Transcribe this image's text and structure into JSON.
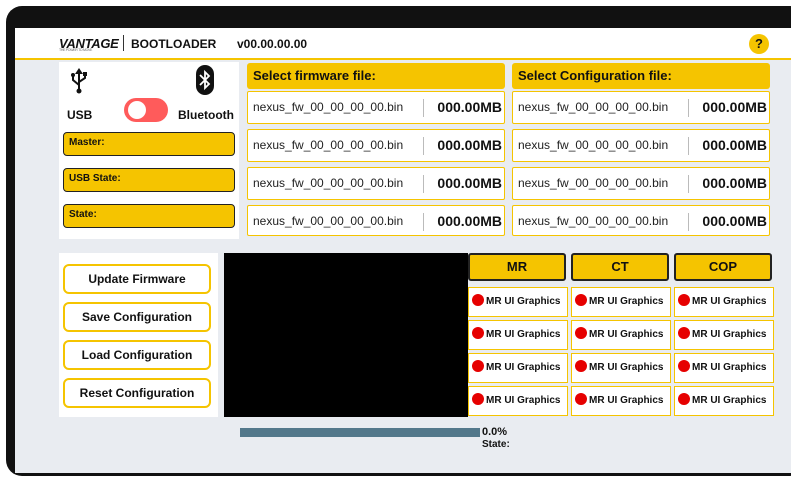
{
  "header": {
    "logo": "VANTAGE",
    "logo_tagline": "THE POWER TO MOVE",
    "title": "BOOTLOADER",
    "version": "v00.00.00.00",
    "help_label": "?"
  },
  "connection": {
    "usb_label": "USB",
    "bluetooth_label": "Bluetooth",
    "toggle_color": "#ff5b5b",
    "fields": [
      {
        "label": "Master:"
      },
      {
        "label": "USB State:"
      },
      {
        "label": "State:"
      }
    ]
  },
  "firmware": {
    "title": "Select firmware file:",
    "files": [
      {
        "name": "nexus_fw_00_00_00_00.bin",
        "size": "000.00MB"
      },
      {
        "name": "nexus_fw_00_00_00_00.bin",
        "size": "000.00MB"
      },
      {
        "name": "nexus_fw_00_00_00_00.bin",
        "size": "000.00MB"
      },
      {
        "name": "nexus_fw_00_00_00_00.bin",
        "size": "000.00MB"
      }
    ]
  },
  "configuration": {
    "title": "Select Configuration file:",
    "files": [
      {
        "name": "nexus_fw_00_00_00_00.bin",
        "size": "000.00MB"
      },
      {
        "name": "nexus_fw_00_00_00_00.bin",
        "size": "000.00MB"
      },
      {
        "name": "nexus_fw_00_00_00_00.bin",
        "size": "000.00MB"
      },
      {
        "name": "nexus_fw_00_00_00_00.bin",
        "size": "000.00MB"
      }
    ]
  },
  "actions": [
    {
      "label": "Update Firmware"
    },
    {
      "label": "Save Configuration"
    },
    {
      "label": "Load Configuration"
    },
    {
      "label": "Reset Configuration"
    }
  ],
  "status_table": {
    "columns": [
      "MR",
      "CT",
      "COP"
    ],
    "rows": [
      [
        "MR UI Graphics",
        "MR UI Graphics",
        "MR UI Graphics"
      ],
      [
        "MR UI Graphics",
        "MR UI Graphics",
        "MR UI Graphics"
      ],
      [
        "MR UI Graphics",
        "MR UI Graphics",
        "MR UI Graphics"
      ],
      [
        "MR UI Graphics",
        "MR UI Graphics",
        "MR UI Graphics"
      ]
    ],
    "indicator_color": "#e60000"
  },
  "progress": {
    "percent": "0.0%",
    "state_label": "State:",
    "bar_color": "#53788b"
  },
  "theme": {
    "accent": "#f5c400",
    "background": "#e9ecf1"
  }
}
